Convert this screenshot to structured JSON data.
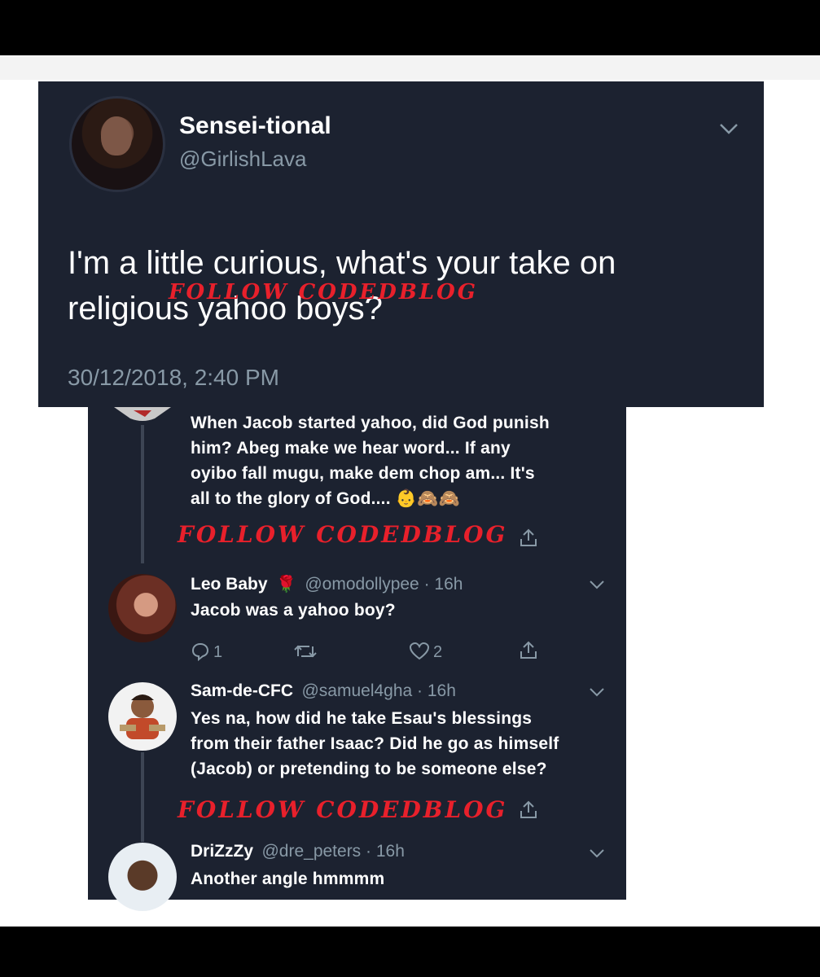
{
  "tweet": {
    "display_name": "Sensei-tional",
    "handle": "@GirlishLava",
    "text_line1": "I'm a little curious, what's your take on",
    "text_line2": "religious yahoo boys?",
    "timestamp": "30/12/2018, 2:40 PM",
    "watermark": "FOLLOW CODEDBLOG"
  },
  "replies": {
    "first_reply_lines": [
      "When Jacob started yahoo, did God punish",
      "him? Abeg make we hear word... If any",
      "oyibo fall mugu, make dem chop am... It's",
      "all to the glory of God.... 👶🙈🙈"
    ],
    "watermark": "FOLLOW CODEDBLOG",
    "items": [
      {
        "name": "Leo Baby",
        "handle": "@omodollypee · 16h",
        "lines": [
          "Jacob was a yahoo boy?"
        ],
        "reply_count": "1",
        "like_count": "2"
      },
      {
        "name": "Sam-de-CFC",
        "handle": "@samuel4gha · 16h",
        "lines": [
          "Yes na, how did he take Esau's blessings",
          "from their father Isaac? Did he go as himself",
          "(Jacob) or pretending to be someone else?"
        ]
      },
      {
        "name": "DriZzZy",
        "handle": "@dre_peters · 16h",
        "lines": [
          "Another angle hmmmm"
        ]
      }
    ]
  },
  "colors": {
    "card_bg": "#1c2230",
    "meta_gray": "#8899a6",
    "watermark_red": "#e8202b"
  }
}
